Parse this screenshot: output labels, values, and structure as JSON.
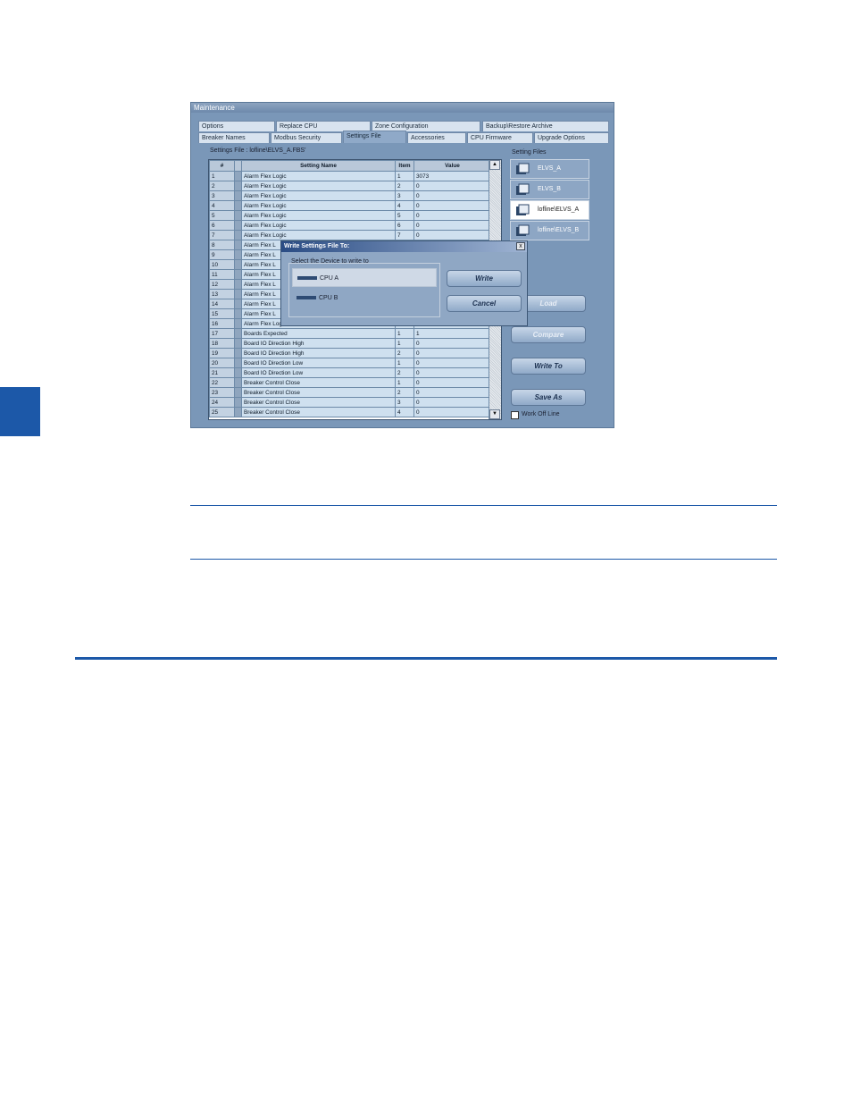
{
  "window": {
    "title": "Maintenance",
    "tabs_row1": [
      "Options",
      "Replace CPU",
      "Zone Configuration",
      "Backup\\Restore Archive"
    ],
    "tabs_row2": [
      "Breaker Names",
      "Modbus Security",
      "Settings File",
      "Accessories",
      "CPU Firmware",
      "Upgrade Options"
    ],
    "active_tab": "Settings File",
    "settings_file_label": "Settings File : lofline\\ELVS_A.FBS'",
    "setting_files_label": "Setting Files"
  },
  "grid": {
    "headers": [
      "#",
      "",
      "Setting Name",
      "Item",
      "Value"
    ],
    "rows": [
      [
        "1",
        "Alarm Flex Logic",
        "1",
        "3073"
      ],
      [
        "2",
        "Alarm Flex Logic",
        "2",
        "0"
      ],
      [
        "3",
        "Alarm Flex Logic",
        "3",
        "0"
      ],
      [
        "4",
        "Alarm Flex Logic",
        "4",
        "0"
      ],
      [
        "5",
        "Alarm Flex Logic",
        "5",
        "0"
      ],
      [
        "6",
        "Alarm Flex Logic",
        "6",
        "0"
      ],
      [
        "7",
        "Alarm Flex Logic",
        "7",
        "0"
      ],
      [
        "8",
        "Alarm Flex L",
        "",
        ""
      ],
      [
        "9",
        "Alarm Flex L",
        "",
        ""
      ],
      [
        "10",
        "Alarm Flex L",
        "",
        ""
      ],
      [
        "11",
        "Alarm Flex L",
        "",
        ""
      ],
      [
        "12",
        "Alarm Flex L",
        "",
        ""
      ],
      [
        "13",
        "Alarm Flex L",
        "",
        ""
      ],
      [
        "14",
        "Alarm Flex L",
        "",
        ""
      ],
      [
        "15",
        "Alarm Flex L",
        "",
        ""
      ],
      [
        "16",
        "Alarm Flex Logic",
        "16",
        "0"
      ],
      [
        "17",
        "Boards Expected",
        "1",
        "1"
      ],
      [
        "18",
        "Board IO Direction High",
        "1",
        "0"
      ],
      [
        "19",
        "Board IO Direction High",
        "2",
        "0"
      ],
      [
        "20",
        "Board IO Direction Low",
        "1",
        "0"
      ],
      [
        "21",
        "Board IO Direction Low",
        "2",
        "0"
      ],
      [
        "22",
        "Breaker Control Close",
        "1",
        "0"
      ],
      [
        "23",
        "Breaker Control Close",
        "2",
        "0"
      ],
      [
        "24",
        "Breaker Control Close",
        "3",
        "0"
      ],
      [
        "25",
        "Breaker Control Close",
        "4",
        "0"
      ]
    ]
  },
  "files": [
    "ELVS_A",
    "ELVS_B",
    "lofline\\ELVS_A",
    "lofline\\ELVS_B"
  ],
  "selected_file_index": 2,
  "buttons": {
    "load": "Load",
    "compare": "Compare",
    "write_to": "Write To",
    "save_as": "Save As"
  },
  "work_offline": "Work Off Line",
  "dialog": {
    "title": "Write Settings File To:",
    "close": "x",
    "group_label": "Select the Device to write to",
    "devices": [
      "CPU A",
      "CPU B"
    ],
    "write": "Write",
    "cancel": "Cancel"
  },
  "colors": {
    "accent": "#1c58a8",
    "window_bg": "#7a97b8"
  }
}
